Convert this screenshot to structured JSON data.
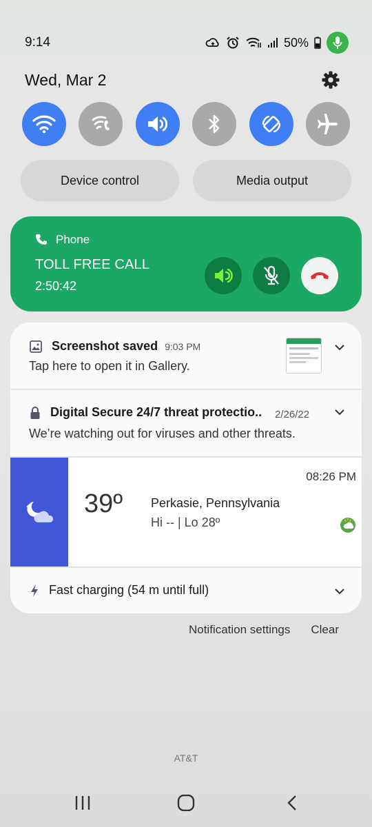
{
  "status": {
    "time": "9:14",
    "battery": "50%",
    "icons": [
      "sync-icon",
      "alarm-icon",
      "wifi-calling-icon",
      "signal-icon",
      "battery-charging-icon",
      "mic-active-icon"
    ]
  },
  "header": {
    "date": "Wed, Mar 2",
    "settings_icon": "gear-icon"
  },
  "quick_toggles": [
    {
      "name": "wifi",
      "icon": "wifi-icon",
      "on": true
    },
    {
      "name": "wifi-calling",
      "icon": "wifi-calling-icon",
      "on": false
    },
    {
      "name": "sound",
      "icon": "volume-icon",
      "on": true
    },
    {
      "name": "bluetooth",
      "icon": "bluetooth-icon",
      "on": false
    },
    {
      "name": "auto-rotate",
      "icon": "auto-rotate-icon",
      "on": true
    },
    {
      "name": "airplane-mode",
      "icon": "airplane-icon",
      "on": false
    }
  ],
  "pills": {
    "device_control": "Device control",
    "media_output": "Media output"
  },
  "call": {
    "app": "Phone",
    "title": "TOLL FREE CALL",
    "timer": "2:50:42",
    "colors": {
      "card": "#1aa864",
      "speaker_active": "#7cf23a",
      "end_call": "#e03030"
    }
  },
  "notifications": {
    "screenshot": {
      "title": "Screenshot saved",
      "time": "9:03 PM",
      "body": "Tap here to open it in Gallery."
    },
    "security": {
      "title": "Digital Secure 24/7 threat protectio..",
      "time": "2/26/22",
      "body": "We’re watching out for viruses and other threats."
    },
    "weather": {
      "temp": "39º",
      "location": "Perkasie, Pennsylvania",
      "hilo": "Hi -- | Lo 28º",
      "time": "08:26 PM"
    },
    "charging": {
      "title": "Fast charging (54 m until full)"
    }
  },
  "actions": {
    "settings": "Notification settings",
    "clear": "Clear"
  },
  "carrier": "AT&T"
}
